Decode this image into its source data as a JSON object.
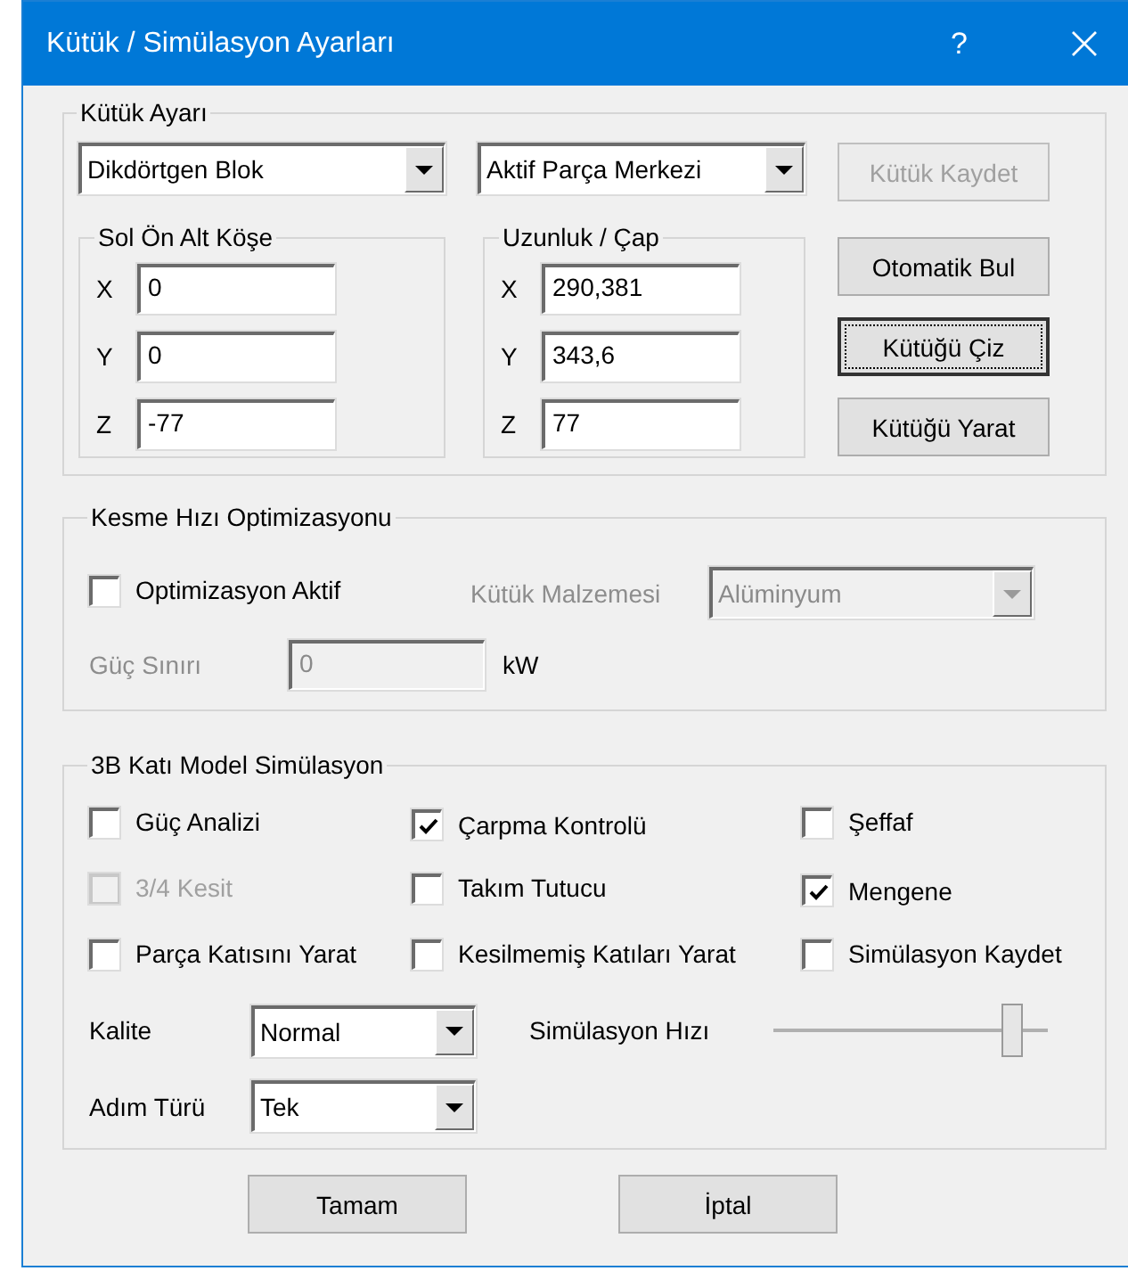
{
  "window": {
    "title": "Kütük / Simülasyon Ayarları",
    "help": "?"
  },
  "kutuk_ayari": {
    "title": "Kütük Ayarı",
    "shape_combo": {
      "value": "Dikdörtgen Blok",
      "disabled": false
    },
    "origin_combo": {
      "value": "Aktif Parça Merkezi",
      "disabled": false
    },
    "corner": {
      "title": "Sol Ön Alt Köşe",
      "fields": [
        {
          "label": "X",
          "value": "0",
          "disabled": false
        },
        {
          "label": "Y",
          "value": "0",
          "disabled": false
        },
        {
          "label": "Z",
          "value": "-77",
          "disabled": false
        }
      ]
    },
    "size": {
      "title": "Uzunluk / Çap",
      "fields": [
        {
          "label": "X",
          "value": "290,381",
          "disabled": false
        },
        {
          "label": "Y",
          "value": "343,6",
          "disabled": false
        },
        {
          "label": "Z",
          "value": "77",
          "disabled": false
        }
      ]
    },
    "buttons": [
      {
        "label": "Kütük Kaydet",
        "disabled": true,
        "focused": false
      },
      {
        "label": "Otomatik Bul",
        "disabled": false,
        "focused": false
      },
      {
        "label": "Kütüğü Çiz",
        "disabled": false,
        "focused": true
      },
      {
        "label": "Kütüğü Yarat",
        "disabled": false,
        "focused": false
      }
    ]
  },
  "kesme_hizi": {
    "title": "Kesme Hızı Optimizasyonu",
    "optimization": {
      "label": "Optimizasyon Aktif",
      "checked": false,
      "disabled": false
    },
    "material": {
      "label": "Kütük Malzemesi",
      "value": "Alüminyum",
      "disabled": true
    },
    "power_limit": {
      "label": "Güç Sınırı",
      "value": "0",
      "unit": "kW",
      "disabled": true
    }
  },
  "simulasyon": {
    "title": "3B Katı Model Simülasyon",
    "checkboxes": [
      {
        "label": "Güç Analizi",
        "checked": false,
        "disabled": false
      },
      {
        "label": "Çarpma Kontrolü",
        "checked": true,
        "disabled": false
      },
      {
        "label": "Şeffaf",
        "checked": false,
        "disabled": false
      },
      {
        "label": "3/4 Kesit",
        "checked": false,
        "disabled": true
      },
      {
        "label": "Takım Tutucu",
        "checked": false,
        "disabled": false
      },
      {
        "label": "Mengene",
        "checked": true,
        "disabled": false
      },
      {
        "label": "Parça Katısını Yarat",
        "checked": false,
        "disabled": false
      },
      {
        "label": "Kesilmemiş Katıları Yarat",
        "checked": false,
        "disabled": false
      },
      {
        "label": "Simülasyon Kaydet",
        "checked": false,
        "disabled": false
      }
    ],
    "quality": {
      "label": "Kalite",
      "value": "Normal",
      "disabled": false
    },
    "speed": {
      "label": "Simülasyon Hızı",
      "level": 0.9
    },
    "step_type": {
      "label": "Adım Türü",
      "value": "Tek",
      "disabled": false
    }
  },
  "buttons": [
    {
      "label": "Tamam",
      "disabled": false,
      "focused": false
    },
    {
      "label": "İptal",
      "disabled": false,
      "focused": false
    }
  ]
}
